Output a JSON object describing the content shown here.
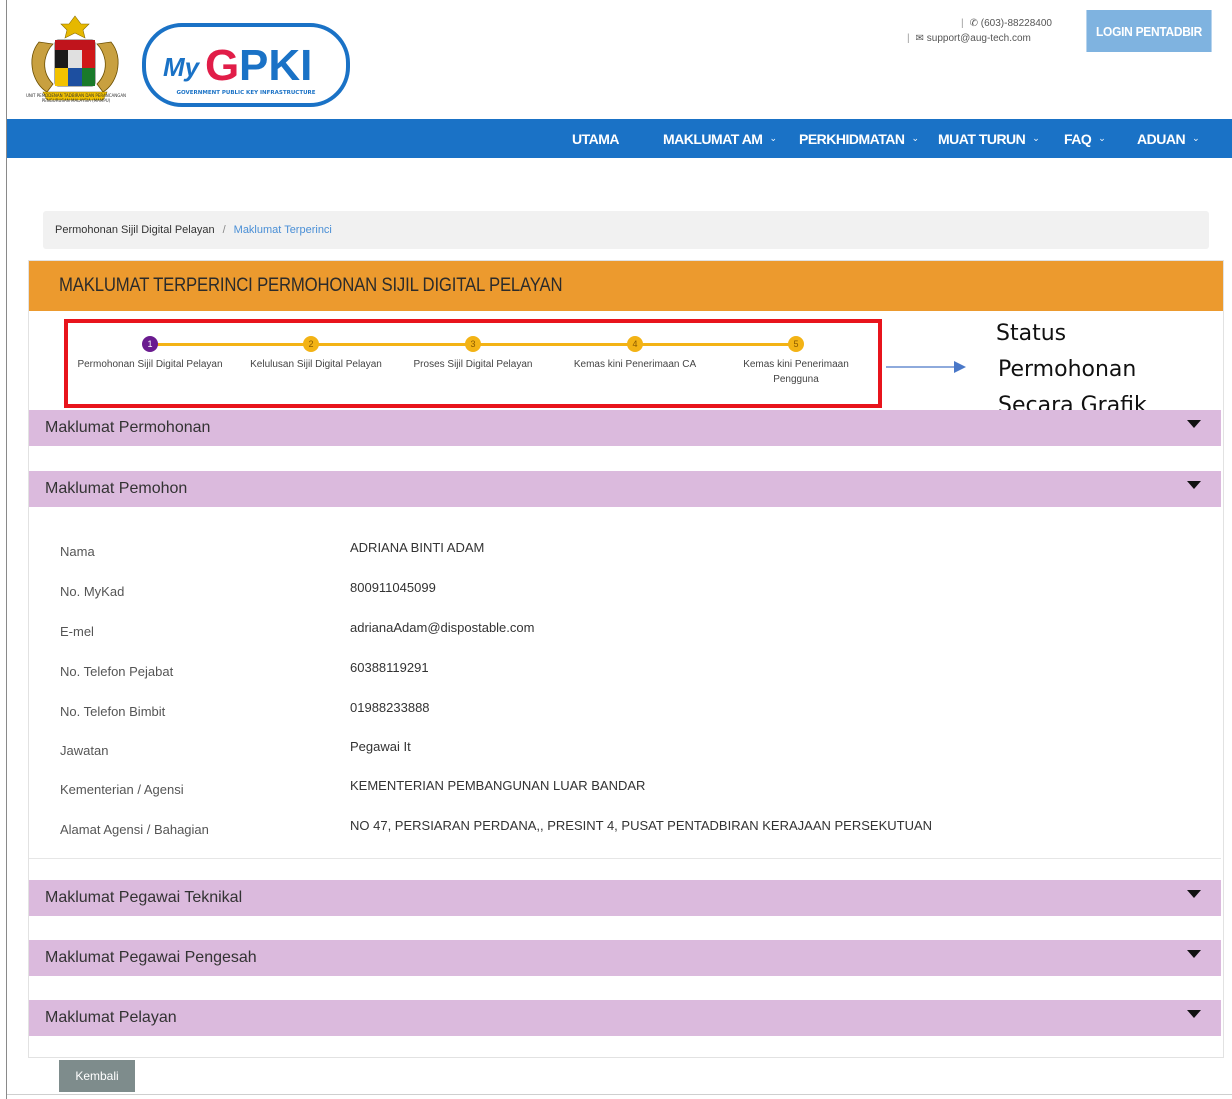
{
  "header": {
    "crest_caption": "UNIT PEMODENAN TADBIRAN DAN PERANCANGAN PENGURUSAN MALAYSIA (MAMPU)",
    "logo_text": "MyGPKI",
    "logo_subtitle": "GOVERNMENT PUBLIC KEY INFRASTRUCTURE",
    "phone": "(603)-88228400",
    "email": "support@aug-tech.com",
    "login_label": "LOGIN PENTADBIR"
  },
  "nav": {
    "items": [
      {
        "label": "UTAMA",
        "dropdown": false
      },
      {
        "label": "MAKLUMAT AM",
        "dropdown": true
      },
      {
        "label": "PERKHIDMATAN",
        "dropdown": true
      },
      {
        "label": "MUAT TURUN",
        "dropdown": true
      },
      {
        "label": "FAQ",
        "dropdown": true
      },
      {
        "label": "ADUAN",
        "dropdown": true
      }
    ],
    "chevron": "⌄"
  },
  "breadcrumb": {
    "parent": "Permohonan Sijil Digital Pelayan",
    "separator": "/",
    "current": "Maklumat Terperinci"
  },
  "panel": {
    "title": "MAKLUMAT TERPERINCI PERMOHONAN SIJIL DIGITAL PELAYAN"
  },
  "stepper": {
    "steps": [
      {
        "number": "1",
        "label": "Permohonan Sijil Digital Pelayan",
        "active": true
      },
      {
        "number": "2",
        "label": "Kelulusan Sijil Digital Pelayan",
        "active": false
      },
      {
        "number": "3",
        "label": "Proses Sijil Digital Pelayan",
        "active": false
      },
      {
        "number": "4",
        "label": "Kemas kini Penerimaan CA",
        "active": false
      },
      {
        "number": "5",
        "label": "Kemas kini Penerimaan Pengguna",
        "active": false
      }
    ]
  },
  "annotation": {
    "lines": [
      "Status",
      "Permohonan",
      "Secara Grafik"
    ]
  },
  "sections": {
    "permohonan": "Maklumat Permohonan",
    "pemohon": "Maklumat Pemohon",
    "teknikal": "Maklumat Pegawai Teknikal",
    "pengesah": "Maklumat Pegawai Pengesah",
    "pelayan": "Maklumat Pelayan"
  },
  "pemohon": {
    "rows": [
      {
        "label": "Nama",
        "value": "ADRIANA BINTI ADAM"
      },
      {
        "label": "No. MyKad",
        "value": "800911045099"
      },
      {
        "label": "E-mel",
        "value": "adrianaAdam@dispostable.com"
      },
      {
        "label": "No. Telefon Pejabat",
        "value": "60388119291"
      },
      {
        "label": "No. Telefon Bimbit",
        "value": "01988233888"
      },
      {
        "label": "Jawatan",
        "value": "Pegawai It"
      },
      {
        "label": "Kementerian / Agensi",
        "value": "KEMENTERIAN PEMBANGUNAN LUAR BANDAR"
      },
      {
        "label": "Alamat Agensi / Bahagian",
        "value": "NO 47, PERSIARAN PERDANA,, PRESINT 4, PUSAT PENTADBIRAN KERAJAAN PERSEKUTUAN"
      }
    ]
  },
  "actions": {
    "back_label": "Kembali"
  },
  "colors": {
    "nav_blue": "#1a72c6",
    "login_blue": "#7fb3e0",
    "title_orange": "#ec9a2e",
    "accordion_lilac": "#dbbadd",
    "step_yellow": "#f3b315",
    "step_active_purple": "#6a1b8f",
    "highlight_red": "#e8141c"
  }
}
